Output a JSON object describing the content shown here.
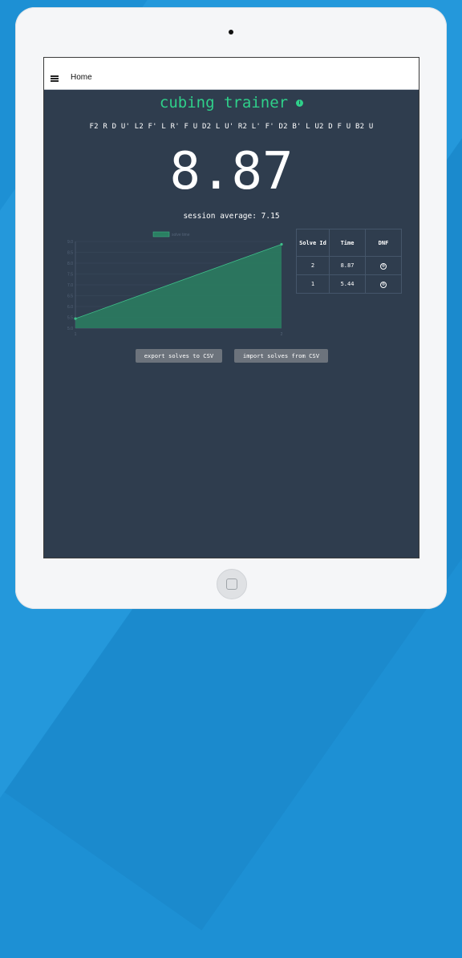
{
  "topbar": {
    "title": "Home",
    "menu_icon": "hamburger-icon"
  },
  "app": {
    "title": "cubing trainer",
    "info_icon": "info-icon"
  },
  "scramble": "F2 R D U' L2 F' L R' F U D2 L U' R2 L' F' D2 B' L U2 D F U B2 U",
  "timer": "8.87",
  "session_average": "session average: 7.15",
  "chart_data": {
    "type": "area",
    "legend": [
      "solve time"
    ],
    "x": [
      1,
      2
    ],
    "x_tick_labels": [
      "1",
      "2"
    ],
    "series": [
      {
        "name": "solve time",
        "values": [
          5.44,
          8.87
        ]
      }
    ],
    "y_tick_labels": [
      "5.0",
      "5.5",
      "6.0",
      "6.5",
      "7.0",
      "7.5",
      "8.0",
      "8.5",
      "9.0"
    ],
    "ylim": [
      5.0,
      9.0
    ],
    "grid": true,
    "colors": {
      "fill": "#2a7f62",
      "line": "#3fbf8a",
      "axis": "#55657a"
    }
  },
  "table": {
    "headers": [
      "Solve Id",
      "Time",
      "DNF"
    ],
    "rows": [
      {
        "id": "2",
        "time": "8.87",
        "dnf": "⊗"
      },
      {
        "id": "1",
        "time": "5.44",
        "dnf": "⊗"
      }
    ]
  },
  "buttons": {
    "export": "export solves to CSV",
    "import": "import solves from CSV"
  },
  "colors": {
    "accent": "#2fd08a",
    "background": "#2f3d4e",
    "button": "#6c737c"
  }
}
